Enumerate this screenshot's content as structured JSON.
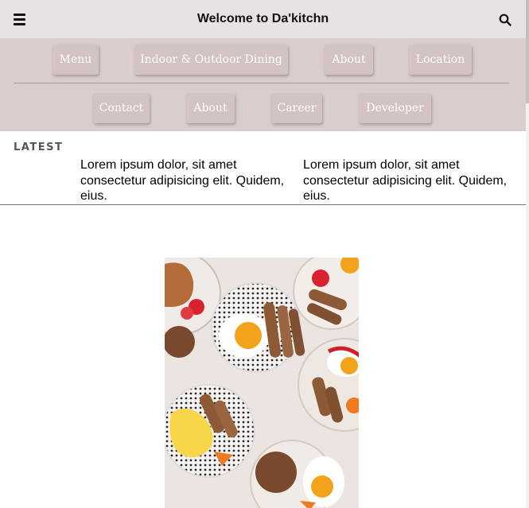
{
  "header": {
    "title": "Welcome to Da'kitchn",
    "menu_icon": "hamburger-menu-icon",
    "search_icon": "search-icon"
  },
  "nav": {
    "row1": [
      "Menu",
      "Indoor & Outdoor Dining",
      "About",
      "Location"
    ],
    "row2": [
      "Contact",
      "About",
      "Career",
      "Developer"
    ]
  },
  "latest": {
    "label": "LATEST",
    "items": [
      "Lorem ipsum dolor, sit amet consectetur adipisicing elit. Quidem, eius.",
      "Lorem ipsum dolor, sit amet consectetur adipisicing elit. Quidem, eius."
    ]
  },
  "hero": {
    "image": "breakfast-plates-photo"
  },
  "colors": {
    "topbar": "#e8e2e2",
    "nav_panel": "#d9cdcd",
    "nav_button": "#d3c3c3"
  }
}
